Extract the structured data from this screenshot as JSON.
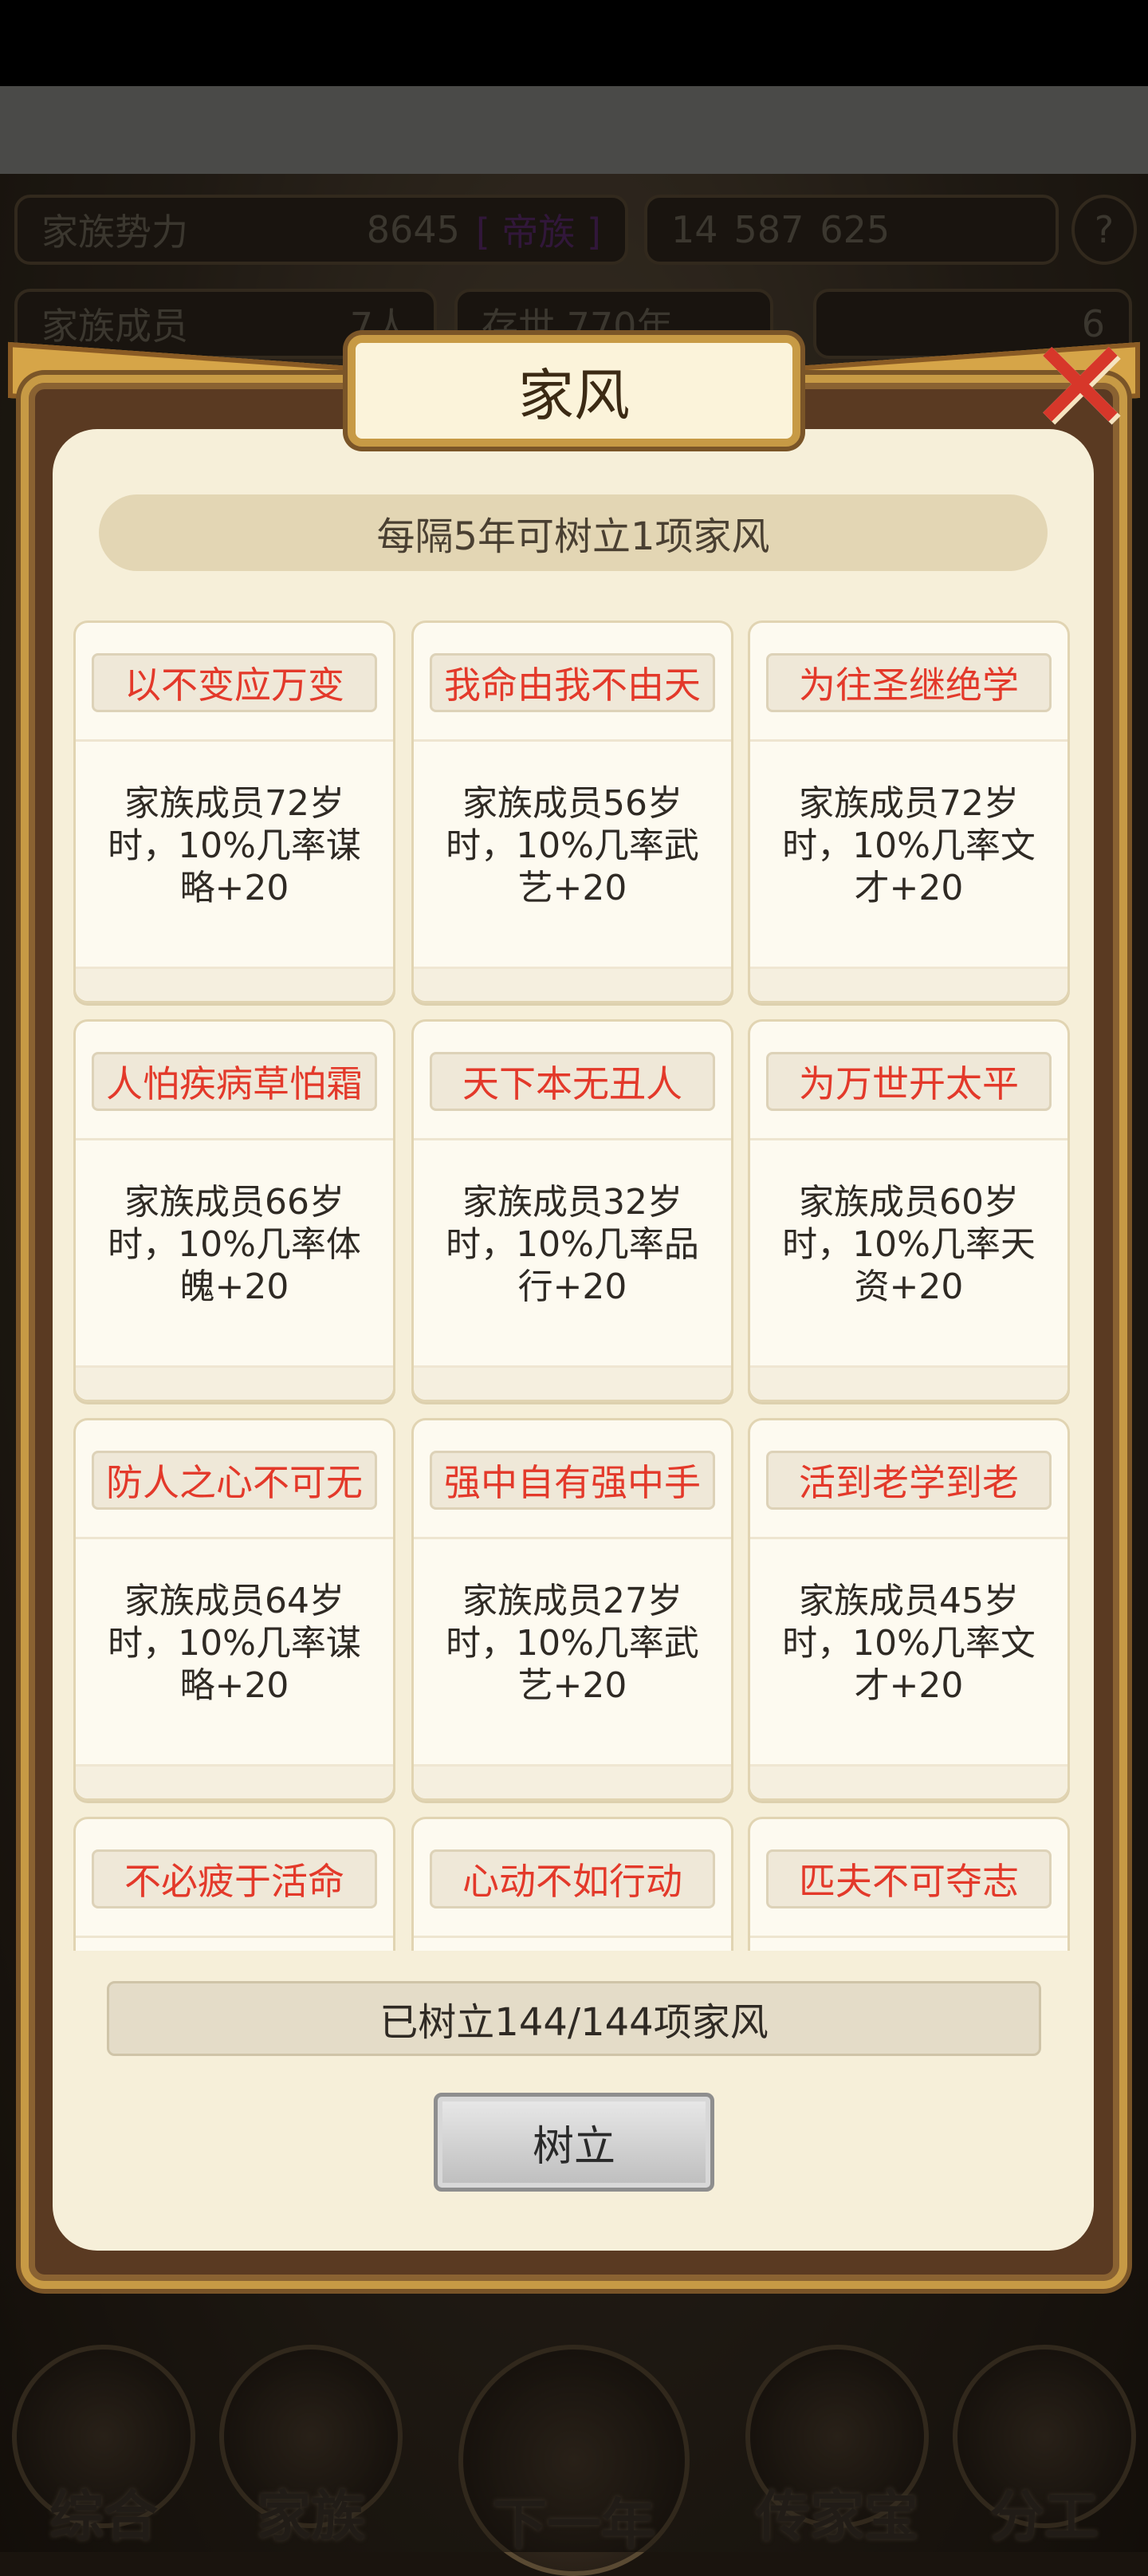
{
  "background": {
    "clan_power_label": "家族势力",
    "clan_power_value": "8645",
    "clan_power_rank": "[ 帝族 ]",
    "currency_1": "14",
    "currency_2": "587",
    "currency_3": "625",
    "members_label": "家族成员",
    "members_value": "7人",
    "existence_label": "存世 770年",
    "gold_value": "6"
  },
  "bottom_nav": [
    {
      "label": "综合"
    },
    {
      "label": "家族"
    },
    {
      "label": "下一年"
    },
    {
      "label": "传家宝"
    },
    {
      "label": "分工"
    }
  ],
  "dialog": {
    "title": "家风",
    "rule_text": "每隔5年可树立1项家风",
    "count_text": "已树立144/144项家风",
    "establish_button": "树立",
    "cards": [
      {
        "title": "以不变应万变",
        "desc": "家族成员72岁时，10%几率谋略+20"
      },
      {
        "title": "我命由我不由天",
        "desc": "家族成员56岁时，10%几率武艺+20"
      },
      {
        "title": "为往圣继绝学",
        "desc": "家族成员72岁时，10%几率文才+20"
      },
      {
        "title": "人怕疾病草怕霜",
        "desc": "家族成员66岁时，10%几率体魄+20"
      },
      {
        "title": "天下本无丑人",
        "desc": "家族成员32岁时，10%几率品行+20"
      },
      {
        "title": "为万世开太平",
        "desc": "家族成员60岁时，10%几率天资+20"
      },
      {
        "title": "防人之心不可无",
        "desc": "家族成员64岁时，10%几率谋略+20"
      },
      {
        "title": "强中自有强中手",
        "desc": "家族成员27岁时，10%几率武艺+20"
      },
      {
        "title": "活到老学到老",
        "desc": "家族成员45岁时，10%几率文才+20"
      },
      {
        "title": "不必疲于活命",
        "desc": ""
      },
      {
        "title": "心动不如行动",
        "desc": ""
      },
      {
        "title": "匹夫不可夺志",
        "desc": ""
      }
    ]
  }
}
